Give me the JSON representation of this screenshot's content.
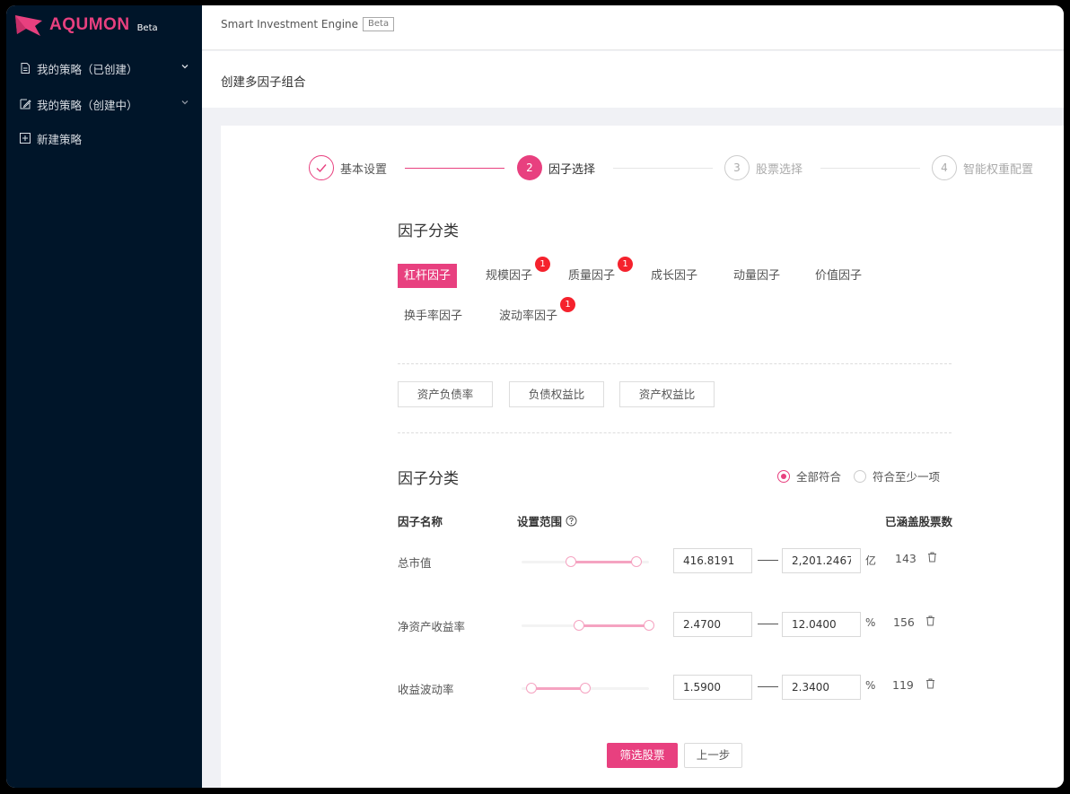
{
  "brand": {
    "name": "AQUMON",
    "beta": "Beta"
  },
  "sidebar": {
    "items": [
      {
        "label": "我的策略（已创建）"
      },
      {
        "label": "我的策略（创建中）"
      },
      {
        "label": "新建策略"
      }
    ]
  },
  "topbar": {
    "title": "Smart Investment Engine",
    "tag": "Beta"
  },
  "page": {
    "title": "创建多因子组合"
  },
  "steps": [
    {
      "number": "",
      "label": "基本设置",
      "state": "done"
    },
    {
      "number": "2",
      "label": "因子选择",
      "state": "active"
    },
    {
      "number": "3",
      "label": "股票选择",
      "state": "wait"
    },
    {
      "number": "4",
      "label": "智能权重配置",
      "state": "wait"
    }
  ],
  "categories": {
    "title": "因子分类",
    "items": [
      {
        "label": "杠杆因子",
        "active": true,
        "badge": ""
      },
      {
        "label": "规模因子",
        "active": false,
        "badge": "1"
      },
      {
        "label": "质量因子",
        "active": false,
        "badge": "1"
      },
      {
        "label": "成长因子",
        "active": false,
        "badge": ""
      },
      {
        "label": "动量因子",
        "active": false,
        "badge": ""
      },
      {
        "label": "价值因子",
        "active": false,
        "badge": ""
      },
      {
        "label": "换手率因子",
        "active": false,
        "badge": ""
      },
      {
        "label": "波动率因子",
        "active": false,
        "badge": "1"
      }
    ]
  },
  "factors": [
    "资产负债率",
    "负债权益比",
    "资产权益比"
  ],
  "selected": {
    "title": "因子分类",
    "radio_all": "全部符合",
    "radio_any": "符合至少一项",
    "radio_selected": "all",
    "col_name": "因子名称",
    "col_range": "设置范围",
    "col_count": "已涵盖股票数",
    "rows": [
      {
        "name": "总市值",
        "min": "416.8191",
        "max": "2,201.2467",
        "unit": "亿",
        "count": "143",
        "slider_low": 0.39,
        "slider_high": 0.9
      },
      {
        "name": "净资产收益率",
        "min": "2.4700",
        "max": "12.0400",
        "unit": "%",
        "count": "156",
        "slider_low": 0.45,
        "slider_high": 1.0
      },
      {
        "name": "收益波动率",
        "min": "1.5900",
        "max": "2.3400",
        "unit": "%",
        "count": "119",
        "slider_low": 0.08,
        "slider_high": 0.5
      }
    ]
  },
  "actions": {
    "filter": "筛选股票",
    "prev": "上一步"
  },
  "colors": {
    "accent": "#e8407f",
    "sidebar_bg": "#001529",
    "badge": "#f5222d"
  }
}
